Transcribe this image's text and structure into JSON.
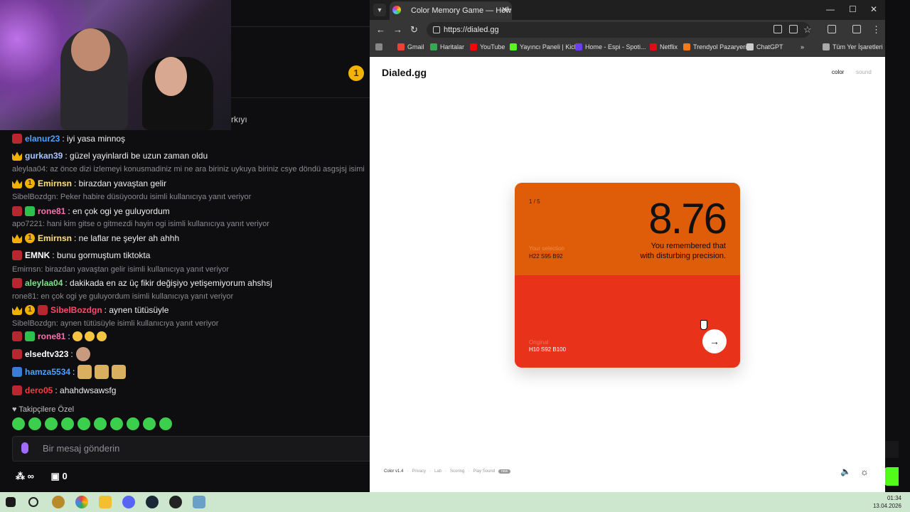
{
  "kick": {
    "header_fragment": "rkıyı",
    "coin_label": "1",
    "chat": [
      {
        "type": "msg",
        "user": "elanur23",
        "user_color": "#4da3ff",
        "text": ": iyi yasa minnoş",
        "badges": [
          "kick"
        ]
      },
      {
        "type": "msg",
        "user": "gurkan39",
        "user_color": "#a9c5ff",
        "text": ": güzel yayinlardi be uzun zaman oldu",
        "badges": [
          "crown"
        ]
      },
      {
        "type": "reply",
        "text": "aleylaa04: az önce dizi izlemeyi konusmadiniz mi ne ara biriniz uykuya biriniz csye döndü asgsjsj isimi"
      },
      {
        "type": "msg",
        "user": "Emirnsn",
        "user_color": "#ffe27a",
        "text": ": birazdan yavaştan gelir",
        "badges": [
          "crown",
          "coin"
        ]
      },
      {
        "type": "reply",
        "text": "SibelBozdgn: Peker habire düsüyoordu isimli kullanıcıya yanıt veriyor"
      },
      {
        "type": "msg",
        "user": "rone81",
        "user_color": "#ff6fb0",
        "text": ": en çok ogi ye guluyordum",
        "badges": [
          "kick",
          "gift"
        ]
      },
      {
        "type": "reply",
        "text": "apo7221: hani kim gitse o gitmezdi hayin ogi isimli kullanıcıya yanıt veriyor"
      },
      {
        "type": "msg",
        "user": "Emirnsn",
        "user_color": "#ffe27a",
        "text": ": ne laflar ne şeyler ah ahhh",
        "badges": [
          "crown",
          "coin"
        ]
      },
      {
        "type": "msg",
        "user": "EMNK",
        "user_color": "#ffffff",
        "text": ": bunu gormuştum tiktokta",
        "badges": [
          "kick"
        ]
      },
      {
        "type": "reply",
        "text": "Emirnsn: birazdan yavaştan gelir isimli kullanıcıya yanıt veriyor"
      },
      {
        "type": "msg",
        "user": "aleylaa04",
        "user_color": "#7ee08a",
        "text": ": dakikada en az üç fikir değişiyo yetişemiyorum ahshsj",
        "badges": [
          "kick"
        ]
      },
      {
        "type": "reply",
        "text": "rone81: en çok ogi ye guluyordum isimli kullanıcıya yanıt veriyor"
      },
      {
        "type": "msg",
        "user": "SibelBozdgn",
        "user_color": "#ff4a6a",
        "text": ": aynen tütüsüyle",
        "badges": [
          "crown",
          "coin",
          "kick"
        ]
      },
      {
        "type": "reply",
        "text": "SibelBozdgn: aynen tütüsüyle isimli kullanıcıya yanıt veriyor"
      },
      {
        "type": "msg",
        "user": "rone81",
        "user_color": "#ff6fb0",
        "text": ":",
        "badges": [
          "kick",
          "gift"
        ]
      },
      {
        "type": "msg",
        "user": "elsedtv323",
        "user_color": "#ffffff",
        "text": ":",
        "badges": [
          "kick"
        ]
      },
      {
        "type": "msg",
        "user": "hamza5534",
        "user_color": "#4da3ff",
        "text": ":",
        "badges": [
          "kick-blue"
        ]
      },
      {
        "type": "msg",
        "user": "dero05",
        "user_color": "#ff3b3b",
        "text": ": ahahdwsawsfg",
        "badges": [
          "kick"
        ]
      }
    ],
    "followers_label": "Takipçilere Özel",
    "input_placeholder": "Bir mesaj gönderin",
    "infinity_label": "∞",
    "gift_count": "0"
  },
  "chrome": {
    "tab_title": "Color Memory Game — How W",
    "url": "https://dialed.gg",
    "bookmarks": [
      "Gmail",
      "Haritalar",
      "YouTube",
      "Yayıncı Paneli | Kick",
      "Home - Espi - Spoti...",
      "Netflix",
      "Trendyol Pazaryeri",
      "ChatGPT",
      "Tüm Yer İşaretleri"
    ]
  },
  "page": {
    "logo": "Dialed.gg",
    "nav_color": "color",
    "nav_sound": "sound",
    "round": "1 / 5",
    "score": "8.76",
    "praise_line1": "You remembered that",
    "praise_line2": "with disturbing precision.",
    "selection_label": "Your selection",
    "selection_value": "H22 S95 B92",
    "original_label": "Original",
    "original_value": "H10 S92 B100",
    "colors": {
      "selection": "#df5c08",
      "original": "#e8331a"
    },
    "footer": [
      "Color v1.4",
      "Privacy",
      "Lab",
      "Scoring",
      "Play Sound"
    ],
    "footer_tag": "new"
  },
  "taskbar": {
    "time": "01:34",
    "date": "13.04.2026"
  }
}
